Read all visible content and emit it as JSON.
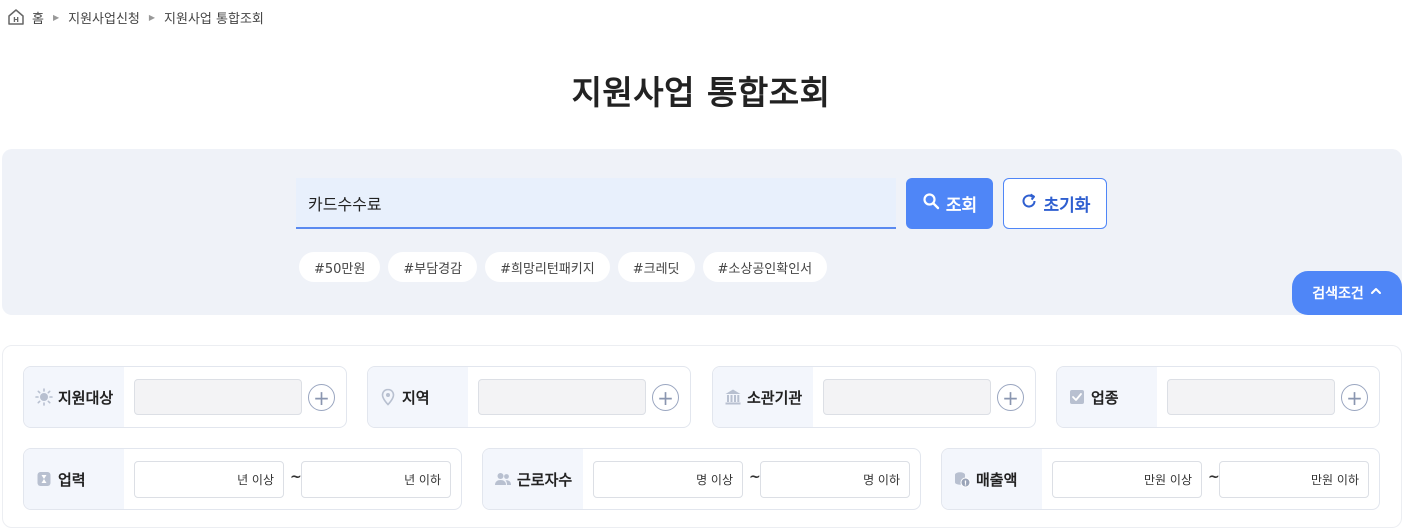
{
  "breadcrumb": {
    "home_icon": "home-icon",
    "home": "홈",
    "level1": "지원사업신청",
    "level2": "지원사업 통합조회"
  },
  "page_title": "지원사업 통합조회",
  "search": {
    "value": "카드수수료",
    "button": "조회",
    "reset": "초기화"
  },
  "tags": [
    "#50만원",
    "#부담경감",
    "#희망리턴패키지",
    "#크레딧",
    "#소상공인확인서"
  ],
  "toggle": "검색조건",
  "filters": {
    "target": "지원대상",
    "region": "지역",
    "agency": "소관기관",
    "industry": "업종"
  },
  "ranges": {
    "history": {
      "label": "업력",
      "min": "년 이상",
      "max": "년 이하"
    },
    "workers": {
      "label": "근로자수",
      "min": "명 이상",
      "max": "명 이하"
    },
    "sales": {
      "label": "매출액",
      "min": "만원 이상",
      "max": "만원 이하"
    }
  },
  "tilde": "~",
  "colors": {
    "accent": "#4f86f7",
    "panel_bg": "#eff2f8",
    "label_bg": "#f3f6fc"
  }
}
